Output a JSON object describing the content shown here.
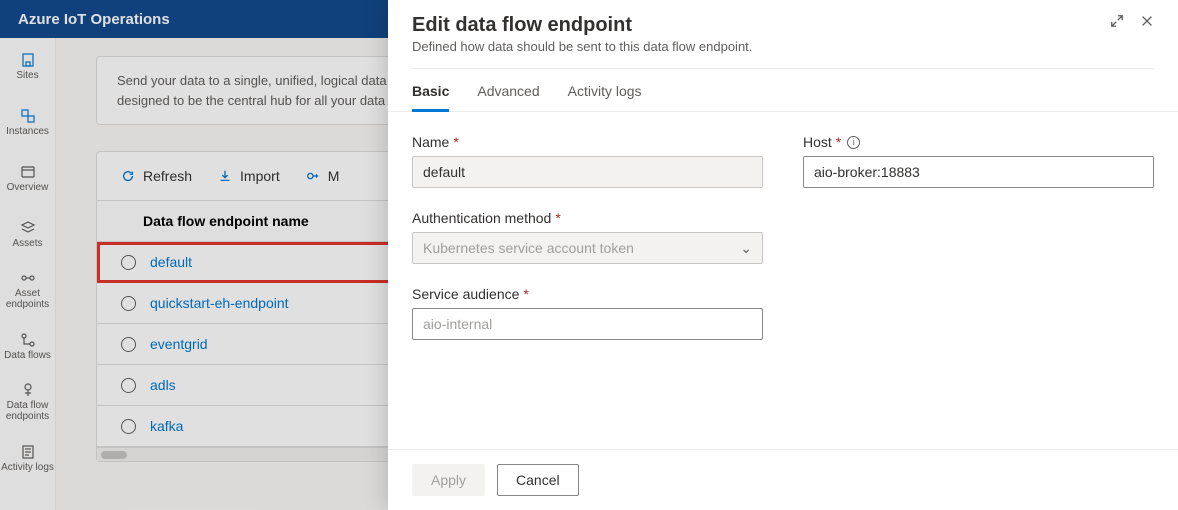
{
  "brand": "Azure IoT Operations",
  "sidenav": {
    "items": [
      {
        "label": "Sites"
      },
      {
        "label": "Instances"
      },
      {
        "label": "Overview"
      },
      {
        "label": "Assets"
      },
      {
        "label": "Asset endpoints"
      },
      {
        "label": "Data flows"
      },
      {
        "label": "Data flow endpoints"
      },
      {
        "label": "Activity logs"
      }
    ]
  },
  "info_card": {
    "line1": "Send your data to a single, unified, logical data",
    "line2": "designed to be the central hub for all your data"
  },
  "toolbar": {
    "refresh": "Refresh",
    "import": "Import",
    "manage": "M"
  },
  "table": {
    "header": "Data flow endpoint name",
    "rows": [
      {
        "name": "default",
        "selected": true
      },
      {
        "name": "quickstart-eh-endpoint",
        "selected": false
      },
      {
        "name": "eventgrid",
        "selected": false
      },
      {
        "name": "adls",
        "selected": false
      },
      {
        "name": "kafka",
        "selected": false
      }
    ]
  },
  "panel": {
    "title": "Edit data flow endpoint",
    "subtitle": "Defined how data should be sent to this data flow endpoint.",
    "tabs": {
      "basic": "Basic",
      "advanced": "Advanced",
      "logs": "Activity logs"
    },
    "fields": {
      "name": {
        "label": "Name",
        "value": "default"
      },
      "host": {
        "label": "Host",
        "value": "aio-broker:18883"
      },
      "auth": {
        "label": "Authentication method",
        "placeholder": "Kubernetes service account token"
      },
      "audience": {
        "label": "Service audience",
        "placeholder": "aio-internal"
      }
    },
    "footer": {
      "apply": "Apply",
      "cancel": "Cancel"
    }
  }
}
